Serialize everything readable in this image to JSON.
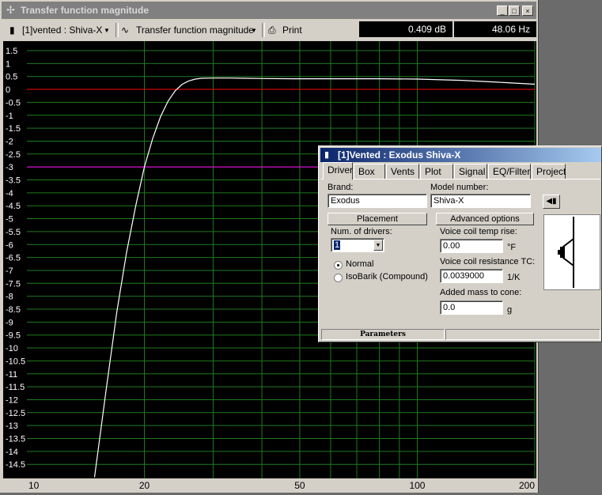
{
  "window": {
    "title": "Transfer function magnitude",
    "controls": [
      "_",
      "□",
      "×"
    ]
  },
  "toolbar": {
    "project_selector": "[1]vented : Shiva-X",
    "graph_selector": "Transfer function magnitude",
    "print_label": "Print",
    "readout_db": "0.409 dB",
    "readout_hz": "48.06 Hz"
  },
  "chart_data": {
    "type": "line",
    "title": "",
    "xlabel": "",
    "ylabel": "",
    "xscale": "log",
    "xlim": [
      10,
      200
    ],
    "ylim": [
      -15,
      1.75
    ],
    "x_ticks": [
      10,
      20,
      50,
      100,
      200
    ],
    "y_ticks": [
      "1.5",
      "1",
      "0.5",
      "0",
      "-0.5",
      "-1",
      "-1.5",
      "-2",
      "-2.5",
      "-3",
      "-3.5",
      "-4",
      "-4.5",
      "-5",
      "-5.5",
      "-6",
      "-6.5",
      "-7",
      "-7.5",
      "-8",
      "-8.5",
      "-9",
      "-9.5",
      "-10",
      "-10.5",
      "-11",
      "-11.5",
      "-12",
      "-12.5",
      "-13",
      "-13.5",
      "-14",
      "-14.5"
    ],
    "grid": true,
    "reference_lines": [
      {
        "y": 0,
        "color": "#ff0000"
      },
      {
        "y": -3,
        "color": "#ff00ff"
      }
    ],
    "series": [
      {
        "color": "#ffffff",
        "x": [
          14.9,
          16,
          17,
          18,
          19,
          20,
          21,
          22,
          23,
          24,
          25,
          26,
          27,
          28,
          30,
          33,
          36,
          40,
          48,
          60,
          80,
          100,
          130,
          160,
          200
        ],
        "y": [
          -15,
          -11.5,
          -8.6,
          -6.3,
          -4.5,
          -3.0,
          -1.9,
          -1.05,
          -0.45,
          -0.05,
          0.2,
          0.33,
          0.4,
          0.43,
          0.44,
          0.44,
          0.43,
          0.42,
          0.41,
          0.41,
          0.41,
          0.4,
          0.35,
          0.28,
          0.2
        ]
      }
    ]
  },
  "dialog": {
    "title": "[1]Vented : Exodus Shiva-X",
    "tabs": [
      "Driver",
      "Box",
      "Vents",
      "Plot",
      "Signal",
      "EQ/Filter",
      "Project"
    ],
    "active_tab": "Driver",
    "brand_label": "Brand:",
    "brand_value": "Exodus",
    "model_label": "Model number:",
    "model_value": "Shiva-X",
    "placement_button": "Placement",
    "advanced_button": "Advanced options",
    "num_drivers_label": "Num. of drivers:",
    "num_drivers_value": "1",
    "radio_normal": "Normal",
    "radio_isobarik": "IsoBarik (Compound)",
    "selected_radio": "Normal",
    "vc_temp_label": "Voice coil temp rise:",
    "vc_temp_value": "0.00",
    "vc_temp_unit": "°F",
    "vc_tc_label": "Voice coil resistance TC:",
    "vc_tc_value": "0.0039000",
    "vc_tc_unit": "1/K",
    "mass_label": "Added mass to cone:",
    "mass_value": "0.0",
    "mass_unit": "g",
    "status_label": "Parameters"
  }
}
